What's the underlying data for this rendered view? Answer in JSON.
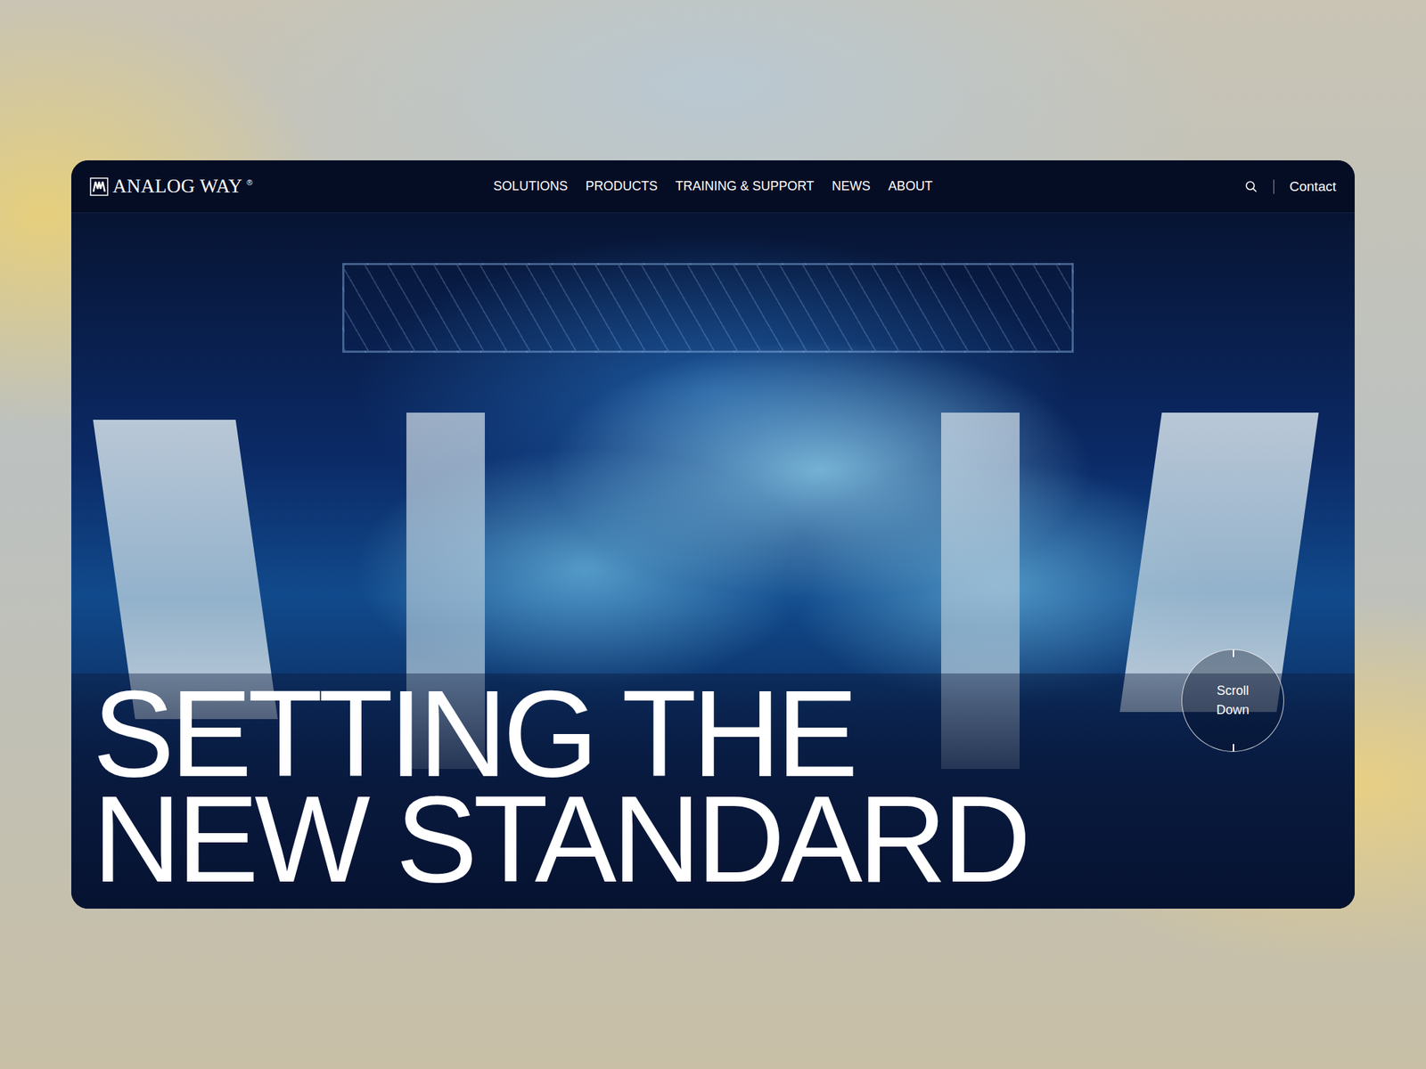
{
  "logo": {
    "name": "ANALOG WAY",
    "mark": "®"
  },
  "nav": [
    "SOLUTIONS",
    "PRODUCTS",
    "TRAINING & SUPPORT",
    "NEWS",
    "ABOUT"
  ],
  "contact": "Contact",
  "headline": [
    "SETTING THE",
    "NEW STANDARD"
  ],
  "scroll": [
    "Scroll",
    "Down"
  ]
}
